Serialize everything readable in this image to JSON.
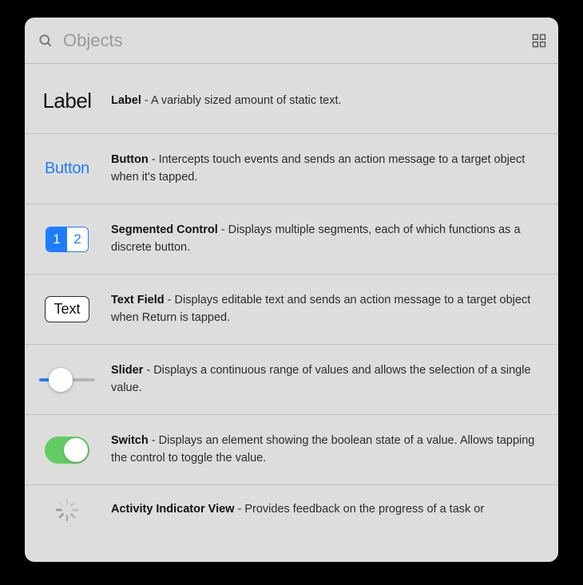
{
  "search": {
    "placeholder": "Objects",
    "value": ""
  },
  "items": [
    {
      "thumb_type": "label",
      "thumb_text": "Label",
      "title": "Label",
      "desc": "A variably sized amount of static text."
    },
    {
      "thumb_type": "button",
      "thumb_text": "Button",
      "title": "Button",
      "desc": "Intercepts touch events and sends an action message to a target object when it's tapped."
    },
    {
      "thumb_type": "segmented",
      "seg_a": "1",
      "seg_b": "2",
      "title": "Segmented Control",
      "desc": "Displays multiple segments, each of which functions as a discrete button."
    },
    {
      "thumb_type": "textfield",
      "thumb_text": "Text",
      "title": "Text Field",
      "desc": "Displays editable text and sends an action message to a target object when Return is tapped."
    },
    {
      "thumb_type": "slider",
      "title": "Slider",
      "desc": "Displays a continuous range of values and allows the selection of a single value."
    },
    {
      "thumb_type": "switch",
      "title": "Switch",
      "desc": "Displays an element showing the boolean state of a value. Allows tapping the control to toggle the value."
    },
    {
      "thumb_type": "spinner",
      "title": "Activity Indicator View",
      "desc": "Provides feedback on the progress of a task or"
    }
  ]
}
